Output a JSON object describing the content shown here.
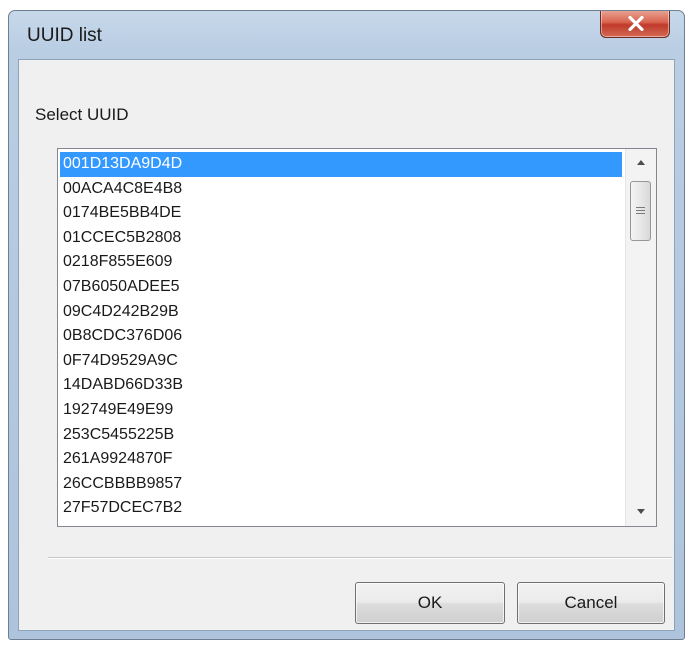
{
  "window": {
    "title": "UUID list"
  },
  "dialog": {
    "label": "Select UUID",
    "selected_index": 0,
    "uuids": [
      "001D13DA9D4D",
      "00ACA4C8E4B8",
      "0174BE5BB4DE",
      "01CCEC5B2808",
      "0218F855E609",
      "07B6050ADEE5",
      "09C4D242B29B",
      "0B8CDC376D06",
      "0F74D9529A9C",
      "14DABD66D33B",
      "192749E49E99",
      "253C5455225B",
      "261A9924870F",
      "26CCBBBB9857",
      "27F57DCEC7B2"
    ]
  },
  "buttons": {
    "ok_label": "OK",
    "cancel_label": "Cancel"
  },
  "icons": {
    "close": "close-icon",
    "scroll_up": "chevron-up-icon",
    "scroll_down": "chevron-down-icon"
  },
  "colors": {
    "selection": "#3399ff",
    "close_button": "#c0392b"
  }
}
